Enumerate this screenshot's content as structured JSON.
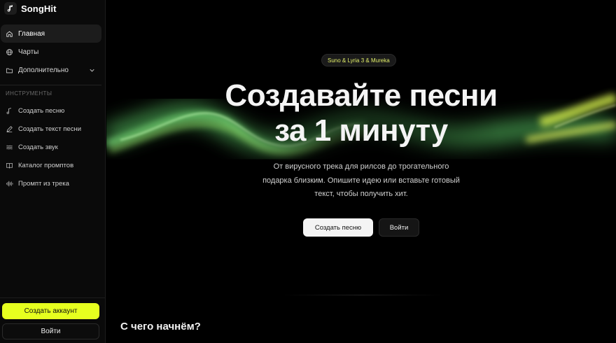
{
  "brand": {
    "name": "SongHit",
    "logo_icon": "music-note-icon"
  },
  "nav": {
    "items": [
      {
        "label": "Главная",
        "icon": "home-icon",
        "active": true
      },
      {
        "label": "Чарты",
        "icon": "globe-icon"
      },
      {
        "label": "Дополнительно",
        "icon": "folder-icon"
      }
    ]
  },
  "tools": {
    "section_label": "ИНСТРУМЕНТЫ",
    "items": [
      {
        "label": "Создать песню",
        "icon": "music-note-icon"
      },
      {
        "label": "Создать текст песни",
        "icon": "pen-icon"
      },
      {
        "label": "Создать звук",
        "icon": "waves-icon"
      },
      {
        "label": "Каталог промптов",
        "icon": "book-icon"
      },
      {
        "label": "Промпт из трека",
        "icon": "audio-lines-icon"
      }
    ]
  },
  "sidebar_bottom": {
    "create_account": "Создать аккаунт",
    "login": "Войти"
  },
  "hero": {
    "badge": "Suno & Lyria 3 & Mureka",
    "title_line1": "Создавайте песни",
    "title_line2": "за 1 минуту",
    "subtitle_line1": "От вирусного трека для рилсов до трогательного",
    "subtitle_line2": "подарка близким. Опишите идею или вставьте готовый",
    "subtitle_line3": "текст, чтобы получить хит.",
    "primary_button": "Создать песню",
    "secondary_button": "Войти"
  },
  "section": {
    "title": "С чего начнём?"
  },
  "colors": {
    "accent": "#e6ff1f",
    "background": "#000000",
    "sidebar": "#0a0a0a"
  }
}
